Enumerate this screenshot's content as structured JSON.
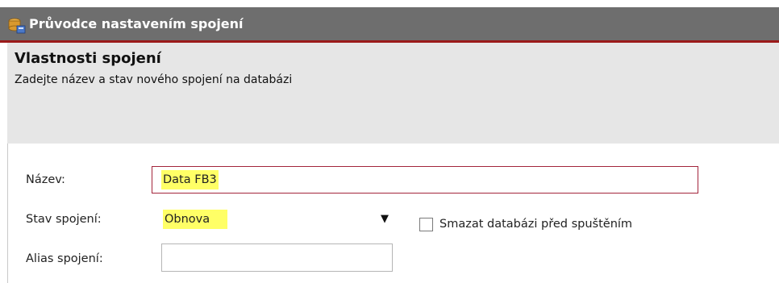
{
  "window": {
    "title": "Průvodce nastavením spojení",
    "icon": "wizard-database-icon"
  },
  "header": {
    "title": "Vlastnosti spojení",
    "subtitle": "Zadejte název a stav nového spojení na databázi"
  },
  "form": {
    "name_label": "Název:",
    "name_value": "Data FB3",
    "state_label": "Stav spojení:",
    "state_value": "Obnova",
    "delete_db_label": "Smazat databázi před spuštěním",
    "delete_db_checked": false,
    "alias_label": "Alias spojení:",
    "alias_value": ""
  },
  "colors": {
    "titlebar": "#6e6e6e",
    "accent": "#9b1a1a",
    "highlight": "#ffff66",
    "header_bg": "#e6e6e6"
  }
}
